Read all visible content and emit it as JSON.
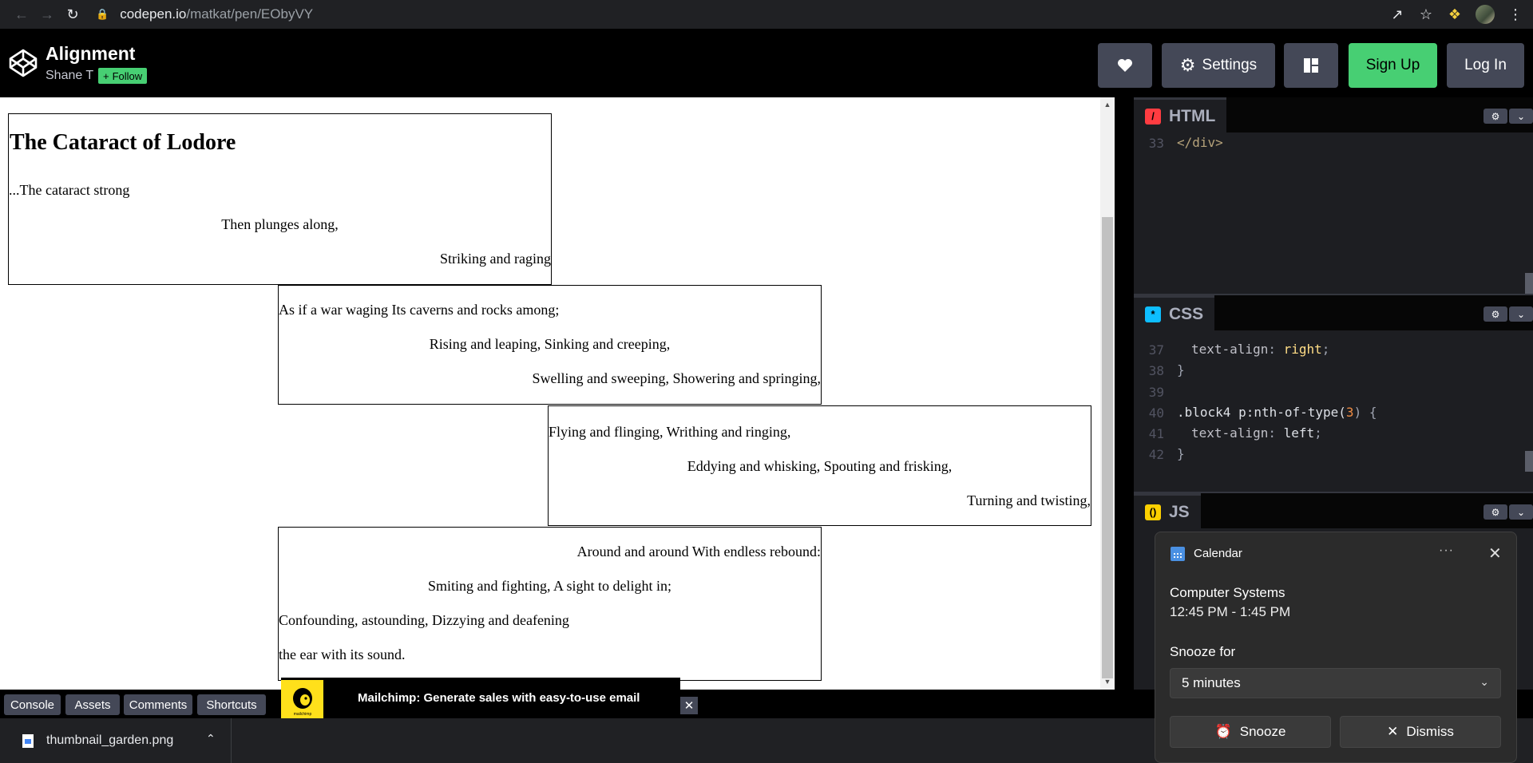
{
  "browser": {
    "url_domain": "codepen.io",
    "url_path": "/matkat/pen/EObyVY"
  },
  "header": {
    "title": "Alignment",
    "author": "Shane T",
    "follow_label": "Follow",
    "settings_label": "Settings",
    "signup_label": "Sign Up",
    "login_label": "Log In"
  },
  "preview": {
    "heading": "The Cataract of Lodore",
    "block1": [
      "...The cataract strong",
      "Then plunges along,",
      "Striking and raging"
    ],
    "block2": [
      "As if a war waging Its caverns and rocks among;",
      "Rising and leaping, Sinking and creeping,",
      "Swelling and sweeping, Showering and springing,"
    ],
    "block3": [
      "Flying and flinging, Writhing and ringing,",
      "Eddying and whisking, Spouting and frisking,",
      "Turning and twisting,"
    ],
    "block4": [
      "Around and around With endless rebound:",
      "Smiting and fighting, A sight to delight in;",
      "Confounding, astounding, Dizzying and deafening",
      "the ear with its sound."
    ]
  },
  "editors": {
    "html": {
      "label": "HTML",
      "lines": [
        {
          "n": "33",
          "code": "</div>"
        }
      ]
    },
    "css": {
      "label": "CSS",
      "lines": [
        {
          "n": "37",
          "prop": "text-align",
          "val": "right"
        },
        {
          "n": "38",
          "code": "}"
        },
        {
          "n": "39",
          "code": ""
        },
        {
          "n": "40",
          "selector": ".block4 p:nth-of-type(",
          "num": "3",
          "after": ") {"
        },
        {
          "n": "41",
          "prop": "text-align",
          "val": "left"
        },
        {
          "n": "42",
          "code": "}"
        }
      ]
    },
    "js": {
      "label": "JS"
    }
  },
  "bottom": {
    "console": "Console",
    "assets": "Assets",
    "comments": "Comments",
    "shortcuts": "Shortcuts",
    "ad_text": "Mailchimp: Generate sales with easy-to-use email",
    "ad_logo_text": "mailchimp"
  },
  "download": {
    "filename": "thumbnail_garden.png"
  },
  "toast": {
    "app": "Calendar",
    "more": "···",
    "event": "Computer Systems",
    "time": "12:45 PM - 1:45 PM",
    "snooze_label": "Snooze for",
    "snooze_value": "5 minutes",
    "snooze_button": "Snooze",
    "dismiss_button": "Dismiss"
  },
  "colors": {
    "codepen_green": "#47cf73",
    "button_gray": "#444857",
    "editor_bg": "#1d1e22",
    "html_icon": "#ff3c41",
    "css_icon": "#0ebeff",
    "js_icon": "#fcd000"
  }
}
